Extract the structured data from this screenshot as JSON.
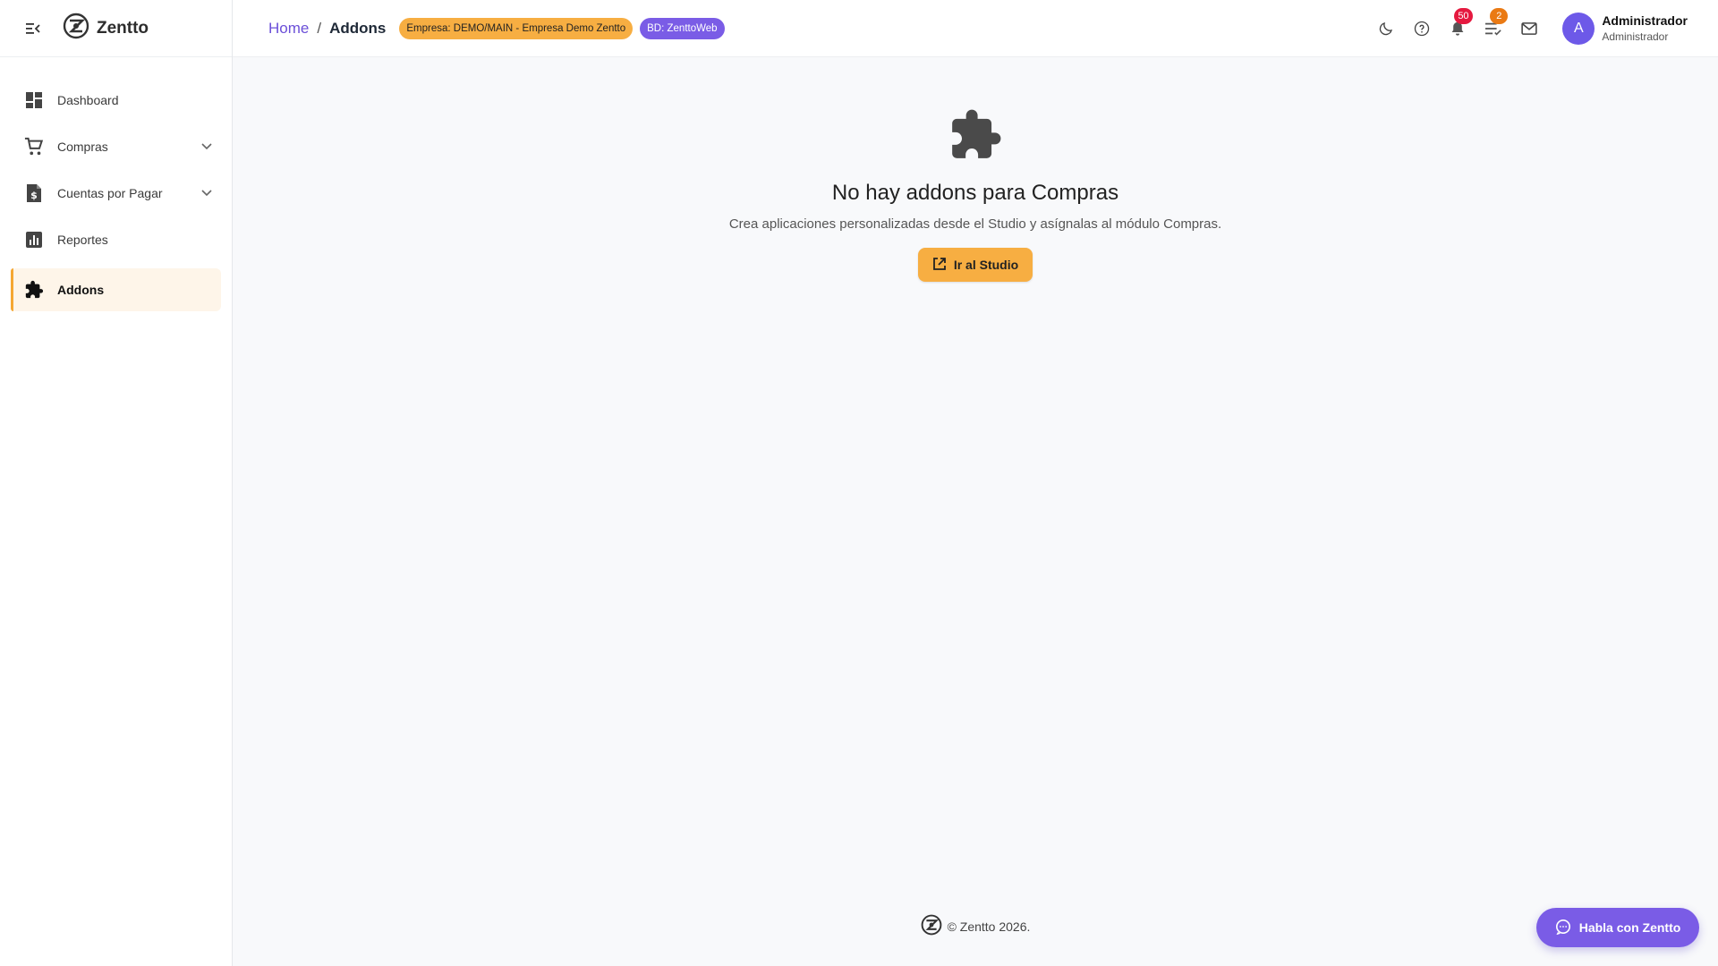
{
  "brand": {
    "name": "Zentto"
  },
  "sidebar": {
    "items": [
      {
        "label": "Dashboard",
        "icon": "dashboard-icon"
      },
      {
        "label": "Compras",
        "icon": "cart-icon",
        "expandable": true
      },
      {
        "label": "Cuentas por Pagar",
        "icon": "invoice-dollar-icon",
        "expandable": true
      },
      {
        "label": "Reportes",
        "icon": "bar-chart-icon"
      },
      {
        "label": "Addons",
        "icon": "puzzle-icon",
        "active": true
      }
    ]
  },
  "topbar": {
    "breadcrumb": {
      "home": "Home",
      "separator": "/",
      "current": "Addons"
    },
    "chips": {
      "empresa": "Empresa: DEMO/MAIN - Empresa Demo Zentto",
      "bd": "BD: ZenttoWeb"
    },
    "notifications_count": "50",
    "tasks_count": "2",
    "user": {
      "initial": "A",
      "name": "Administrador",
      "role": "Administrador"
    }
  },
  "main": {
    "empty_title": "No hay addons para Compras",
    "empty_description": "Crea aplicaciones personalizadas desde el Studio y asígnalas al módulo Compras.",
    "studio_button": "Ir al Studio"
  },
  "footer": {
    "copyright": "© Zentto 2026."
  },
  "chat": {
    "label": "Habla con Zentto"
  },
  "colors": {
    "accent": "#f7ae42",
    "primary": "#7a5ce6",
    "badge_red": "#e5193f",
    "badge_orange": "#ea7a14"
  }
}
